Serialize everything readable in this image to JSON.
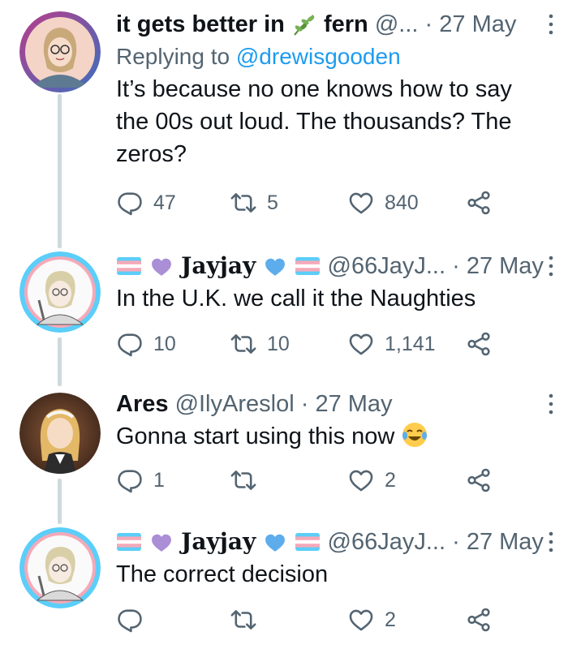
{
  "tweets": [
    {
      "name": "it gets better in",
      "name_emoji": "herb-icon",
      "name_suffix": "fern",
      "handle": "@...",
      "dot": "·",
      "date": "27 May",
      "replying_prefix": "Replying to",
      "replying_handle": "@drewisgooden",
      "text_lines": [
        "It’s because no one knows how to say",
        "the 00s out loud. The thousands? The",
        "zeros?"
      ],
      "replies": "47",
      "retweets": "5",
      "likes": "840"
    },
    {
      "name_prefix_emojis": [
        "transgender-flag-icon",
        "purple-heart-icon"
      ],
      "name": "Jayjay",
      "name_suffix_emojis": [
        "blue-heart-icon",
        "transgender-flag-icon"
      ],
      "handle": "@66JayJ...",
      "dot": "·",
      "date": "27 May",
      "text_lines": [
        "In the U.K. we call it the Naughties"
      ],
      "replies": "10",
      "retweets": "10",
      "likes": "1,141"
    },
    {
      "name": "Ares",
      "handle": "@IlyAreslol",
      "dot": "·",
      "date": "27 May",
      "text_lines": [
        "Gonna start using this now"
      ],
      "text_emoji": "face-with-tears-of-joy-icon",
      "replies": "1",
      "retweets": "",
      "likes": "2"
    },
    {
      "name_prefix_emojis": [
        "transgender-flag-icon",
        "purple-heart-icon"
      ],
      "name": "Jayjay",
      "name_suffix_emojis": [
        "blue-heart-icon",
        "transgender-flag-icon"
      ],
      "handle": "@66JayJ...",
      "dot": "·",
      "date": "27 May",
      "text_lines": [
        "The correct decision"
      ],
      "replies": "",
      "retweets": "",
      "likes": "2"
    }
  ],
  "colors": {
    "text": "#0f1419",
    "secondary": "#536471",
    "link": "#1d9bf0",
    "thread_line": "#cfd9de"
  }
}
